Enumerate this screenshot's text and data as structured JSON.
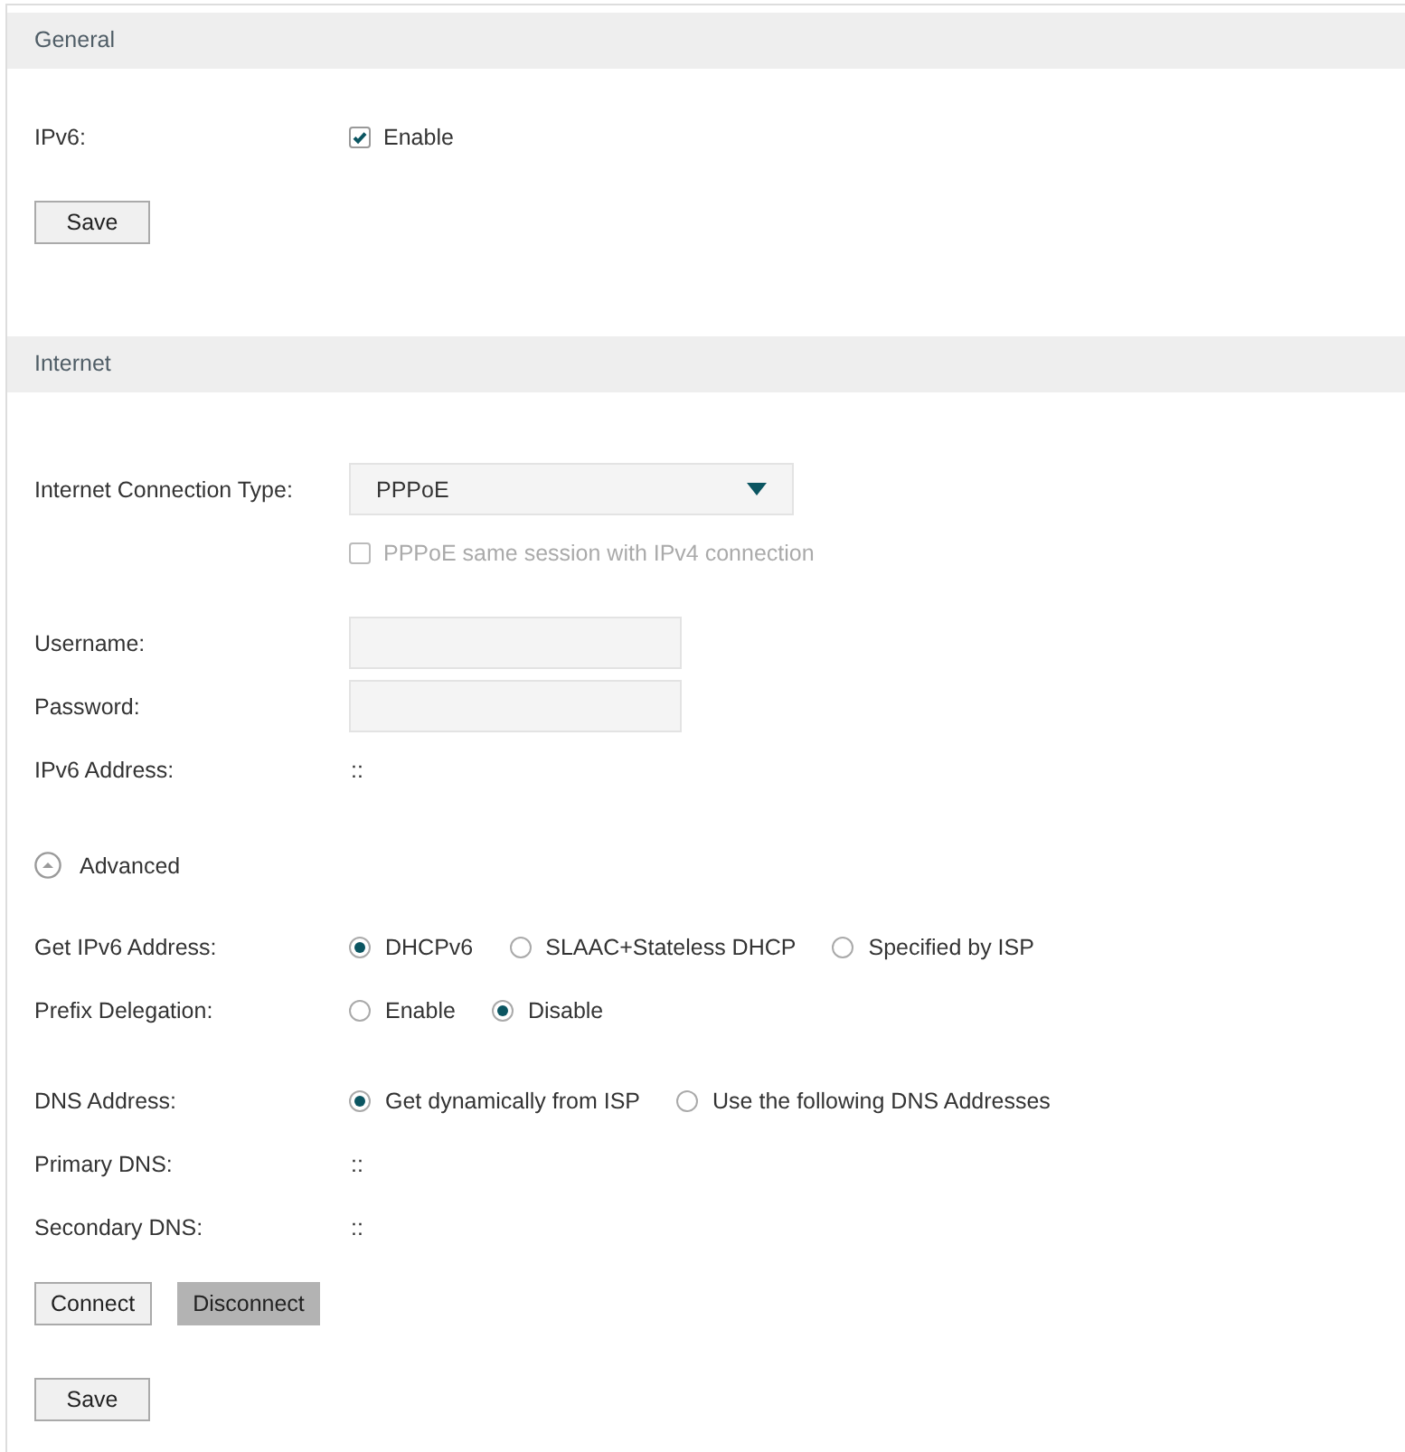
{
  "sections": [
    {
      "title": "General",
      "groups": [
        [
          {
            "kind": "checkbox",
            "label": "IPv6:",
            "text": "Enable",
            "checked": true,
            "disabled": false
          }
        ],
        [
          {
            "kind": "buttons",
            "buttons": [
              {
                "label": "Save",
                "pressed": false
              }
            ]
          }
        ]
      ]
    },
    {
      "title": "Internet",
      "groups": [
        [
          {
            "kind": "select",
            "label": "Internet Connection Type:",
            "value": "PPPoE"
          },
          {
            "kind": "checkbox",
            "text": "PPPoE same session with IPv4 connection",
            "checked": false,
            "disabled": true
          }
        ],
        [
          {
            "kind": "field",
            "label": "Username:"
          },
          {
            "kind": "field",
            "label": "Password:"
          },
          {
            "kind": "text",
            "label": "IPv6 Address:",
            "value": "::"
          }
        ],
        [
          {
            "kind": "toggle",
            "text": "Advanced",
            "expanded": true
          }
        ],
        [
          {
            "kind": "radio",
            "label": "Get IPv6 Address:",
            "options": [
              {
                "text": "DHCPv6",
                "selected": true
              },
              {
                "text": "SLAAC+Stateless DHCP",
                "selected": false
              },
              {
                "text": "Specified by ISP",
                "selected": false
              }
            ]
          },
          {
            "kind": "radio",
            "label": "Prefix Delegation:",
            "options": [
              {
                "text": "Enable",
                "selected": false
              },
              {
                "text": "Disable",
                "selected": true
              }
            ]
          }
        ],
        [
          {
            "kind": "radio",
            "label": "DNS Address:",
            "options": [
              {
                "text": "Get dynamically from ISP",
                "selected": true
              },
              {
                "text": "Use the following DNS Addresses",
                "selected": false
              }
            ]
          },
          {
            "kind": "text",
            "label": "Primary DNS:",
            "value": "::"
          },
          {
            "kind": "text",
            "label": "Secondary DNS:",
            "value": "::"
          }
        ],
        [
          {
            "kind": "buttons",
            "buttons": [
              {
                "label": "Connect",
                "pressed": false
              },
              {
                "label": "Disconnect",
                "pressed": true
              }
            ]
          }
        ],
        [
          {
            "kind": "buttons",
            "buttons": [
              {
                "label": "Save",
                "pressed": false
              }
            ]
          }
        ]
      ]
    }
  ]
}
